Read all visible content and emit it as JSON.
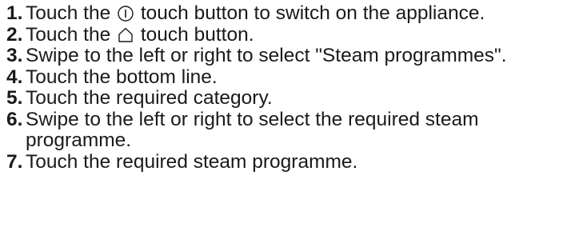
{
  "steps": [
    {
      "number": "1.",
      "before_icon": "Touch the ",
      "icon": "power-icon",
      "after_icon": " touch button to switch on the appliance."
    },
    {
      "number": "2.",
      "before_icon": "Touch the ",
      "icon": "home-icon",
      "after_icon": " touch button."
    },
    {
      "number": "3.",
      "text": "Swipe to the left or right to select \"Steam programmes\"."
    },
    {
      "number": "4.",
      "text": "Touch the bottom line."
    },
    {
      "number": "5.",
      "text": "Touch the required category."
    },
    {
      "number": "6.",
      "text": "Swipe to the left or right to select the required steam programme."
    },
    {
      "number": "7.",
      "text": "Touch the required steam programme."
    }
  ]
}
